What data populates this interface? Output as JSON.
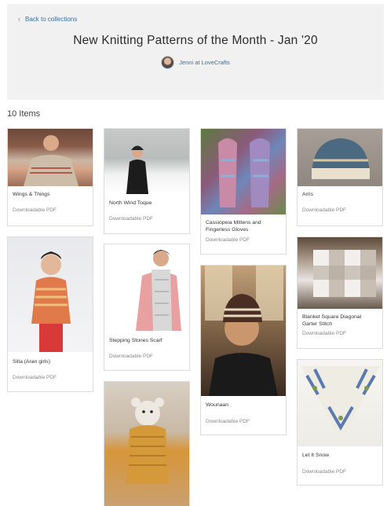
{
  "header": {
    "back_label": "Back to collections",
    "title": "New Knitting Patterns of the Month - Jan '20",
    "author": "Jenni at LoveCrafts"
  },
  "count_label": "10 Items",
  "cards": [
    {
      "name": "Wings & Things",
      "format": "Downloadable PDF"
    },
    {
      "name": "North Wind Toque",
      "format": "Downloadable PDF"
    },
    {
      "name": "Cassiopeia Mittens and Fingerless Gloves",
      "format": "Downloadable PDF"
    },
    {
      "name": "Arris",
      "format": "Downloadable PDF"
    },
    {
      "name": "Silla (Aran girls)",
      "format": "Downloadable PDF"
    },
    {
      "name": "Stepping Stones Scarf",
      "format": "Downloadable PDF"
    },
    {
      "name": "Wounaan",
      "format": "Downloadable PDF"
    },
    {
      "name": "Blanket Square Diagonal Garter Stitch",
      "format": "Downloadable PDF"
    },
    {
      "name": "Let It Snow",
      "format": "Downloadable PDF"
    },
    {
      "name": "",
      "format": ""
    }
  ]
}
